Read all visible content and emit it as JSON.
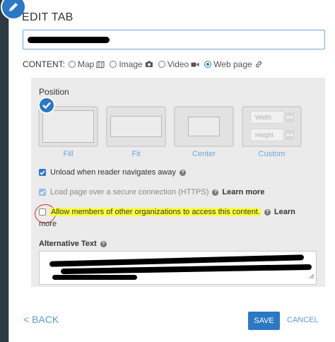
{
  "dialog": {
    "title": "EDIT TAB",
    "name_input_value": ""
  },
  "content": {
    "label": "CONTENT:",
    "options": [
      {
        "label": "Map",
        "icon": "map-icon",
        "selected": false
      },
      {
        "label": "Image",
        "icon": "camera-icon",
        "selected": false
      },
      {
        "label": "Video",
        "icon": "video-camera-icon",
        "selected": false
      },
      {
        "label": "Web page",
        "icon": "link-icon",
        "selected": true
      }
    ]
  },
  "position": {
    "label": "Position",
    "selected": "Fill",
    "options": [
      {
        "label": "Fill"
      },
      {
        "label": "Fit"
      },
      {
        "label": "Center"
      },
      {
        "label": "Custom"
      }
    ],
    "custom_width_placeholder": "Width",
    "custom_height_placeholder": "Height"
  },
  "options": {
    "unload": {
      "label": "Unload when reader navigates away",
      "checked": true
    },
    "secure": {
      "label": "Load page over a secure connection (HTTPS)",
      "checked": true,
      "disabled": true,
      "learn_more": "Learn more"
    },
    "allow_orgs": {
      "label": "Allow members of other organizations to access this content.",
      "checked": false,
      "learn_more_start": "Learn",
      "learn_more_end": "more"
    }
  },
  "alt_text": {
    "label": "Alternative Text",
    "value": ""
  },
  "footer": {
    "back_label": "< BACK",
    "save_label": "SAVE",
    "cancel_label": "CANCEL"
  },
  "colors": {
    "accent": "#2b78c5",
    "link": "#5b9bd5",
    "highlight": "#fbff3f",
    "annotation": "#d4302a"
  }
}
